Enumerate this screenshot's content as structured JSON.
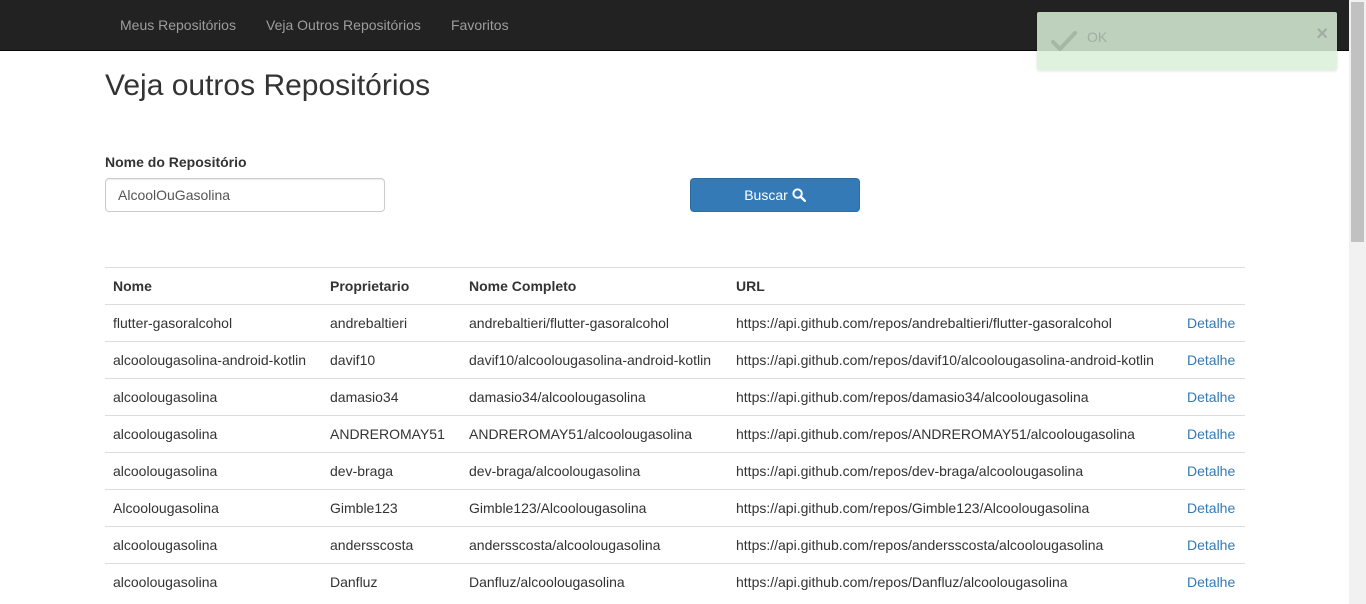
{
  "nav": {
    "items": [
      {
        "label": "Meus Repositórios"
      },
      {
        "label": "Veja Outros Repositórios"
      },
      {
        "label": "Favoritos"
      }
    ]
  },
  "page": {
    "title": "Veja outros Repositórios"
  },
  "search": {
    "label": "Nome do Repositório",
    "value": "AlcoolOuGasolina",
    "button_label": "Buscar",
    "button_icon": "search-icon"
  },
  "table": {
    "headers": [
      "Nome",
      "Proprietario",
      "Nome Completo",
      "URL",
      ""
    ],
    "link_label": "Detalhe",
    "rows": [
      {
        "nome": "flutter-gasoralcohol",
        "proprietario": "andrebaltieri",
        "nome_completo": "andrebaltieri/flutter-gasoralcohol",
        "url": "https://api.github.com/repos/andrebaltieri/flutter-gasoralcohol"
      },
      {
        "nome": "alcoolougasolina-android-kotlin",
        "proprietario": "davif10",
        "nome_completo": "davif10/alcoolougasolina-android-kotlin",
        "url": "https://api.github.com/repos/davif10/alcoolougasolina-android-kotlin"
      },
      {
        "nome": "alcoolougasolina",
        "proprietario": "damasio34",
        "nome_completo": "damasio34/alcoolougasolina",
        "url": "https://api.github.com/repos/damasio34/alcoolougasolina"
      },
      {
        "nome": "alcoolougasolina",
        "proprietario": "ANDREROMAY51",
        "nome_completo": "ANDREROMAY51/alcoolougasolina",
        "url": "https://api.github.com/repos/ANDREROMAY51/alcoolougasolina"
      },
      {
        "nome": "alcoolougasolina",
        "proprietario": "dev-braga",
        "nome_completo": "dev-braga/alcoolougasolina",
        "url": "https://api.github.com/repos/dev-braga/alcoolougasolina"
      },
      {
        "nome": "Alcoolougasolina",
        "proprietario": "Gimble123",
        "nome_completo": "Gimble123/Alcoolougasolina",
        "url": "https://api.github.com/repos/Gimble123/Alcoolougasolina"
      },
      {
        "nome": "alcoolougasolina",
        "proprietario": "andersscosta",
        "nome_completo": "andersscosta/alcoolougasolina",
        "url": "https://api.github.com/repos/andersscosta/alcoolougasolina"
      },
      {
        "nome": "alcoolougasolina",
        "proprietario": "Danfluz",
        "nome_completo": "Danfluz/alcoolougasolina",
        "url": "https://api.github.com/repos/Danfluz/alcoolougasolina"
      }
    ]
  },
  "toast": {
    "message": "OK",
    "icon": "checkmark-icon",
    "close_label": "×"
  },
  "colors": {
    "navbar_bg": "#222222",
    "nav_text": "#9d9d9d",
    "primary": "#337ab7",
    "link": "#337ab7",
    "toast_bg": "#d9f0d9"
  }
}
